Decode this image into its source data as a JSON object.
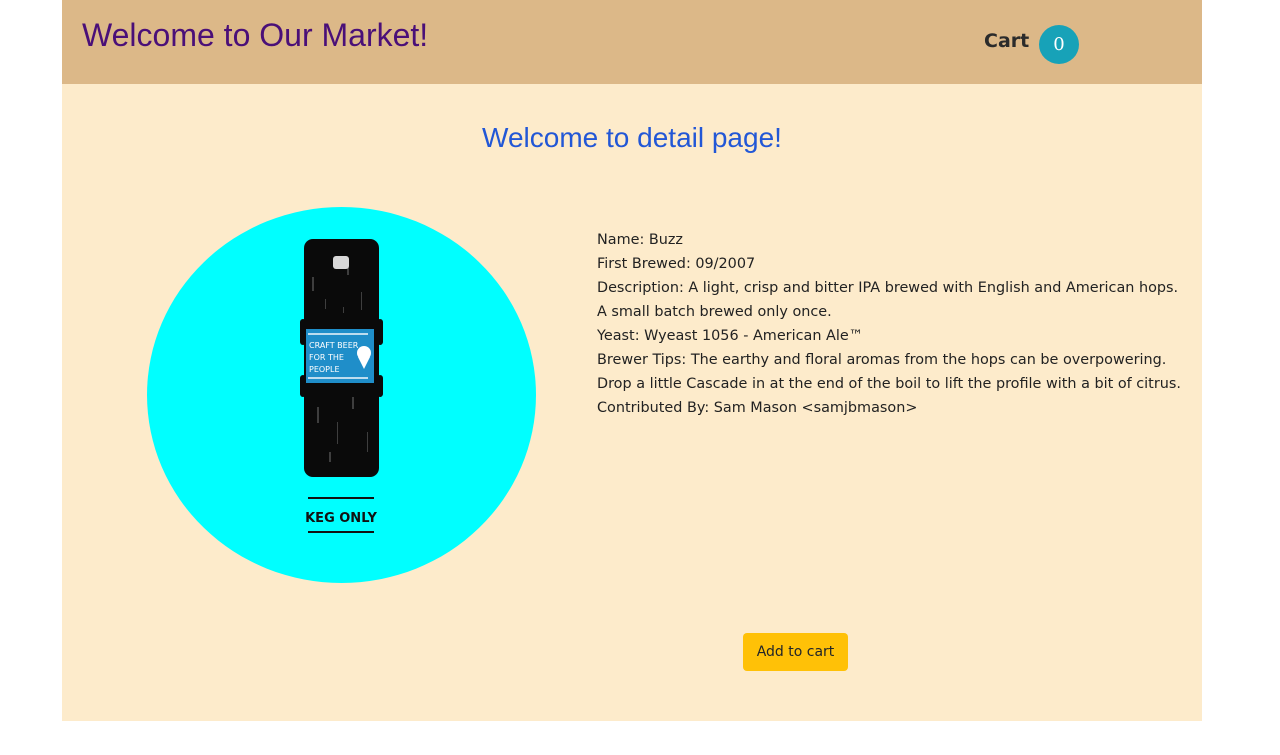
{
  "header": {
    "brand": "Welcome to Our Market!",
    "cart_label": "Cart",
    "cart_count": "0"
  },
  "page": {
    "title": "Welcome to detail page!"
  },
  "product": {
    "image_label_lines": [
      "CRAFT BEER",
      "FOR THE",
      "PEOPLE"
    ],
    "image_caption": "KEG ONLY",
    "name": "Name: Buzz",
    "first_brewed": "First Brewed: 09/2007",
    "description": "Description: A light, crisp and bitter IPA brewed with English and American hops.",
    "description_2": "A small batch brewed only once.",
    "yeast": "Yeast: Wyeast 1056 - American Ale™",
    "brewer_tips": "Brewer Tips: The earthy and floral aromas from the hops can be overpowering.",
    "brewer_tips_2": "Drop a little Cascade in at the end of the boil to lift the profile with a bit of citrus.",
    "contributed_by": "Contributed By: Sam Mason <samjbmason>"
  },
  "actions": {
    "add_to_cart": "Add to cart"
  },
  "colors": {
    "header_bg": "#dcb888",
    "page_bg": "#fdebcb",
    "brand_text": "#4a0f78",
    "title_text": "#2257d6",
    "badge_bg": "#17a2b8",
    "image_bg": "#00ffff",
    "button_bg": "#ffc107"
  }
}
